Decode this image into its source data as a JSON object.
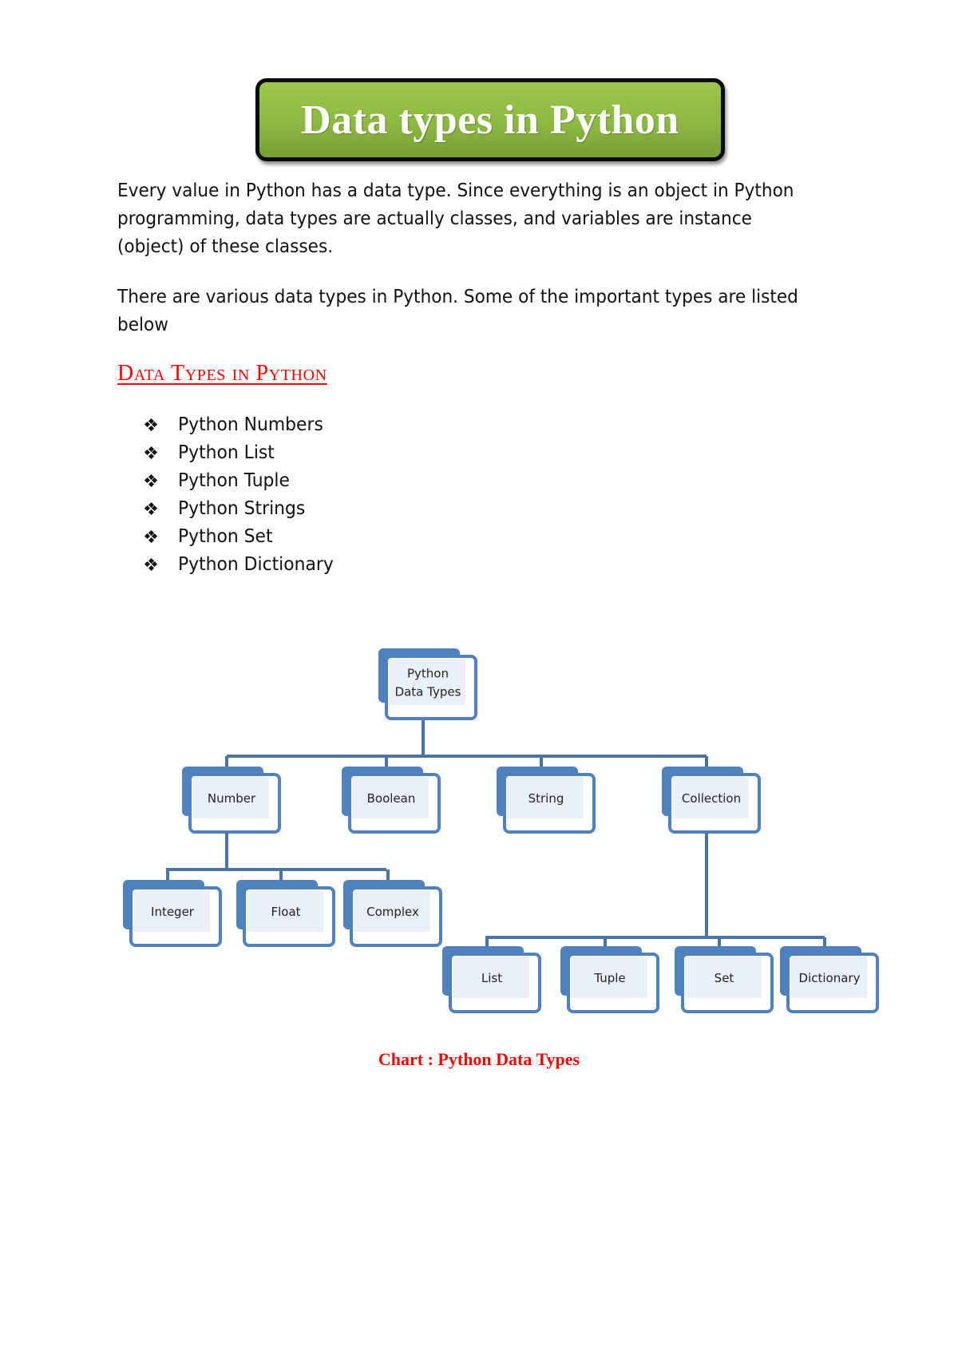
{
  "title": "Data types in Python",
  "paragraphs": [
    "Every value in Python has a data type. Since everything is an object in Python programming, data types are actually classes, and variables are instance (object) of these classes.",
    "There are various data types in Python. Some of the important types are listed below"
  ],
  "section_heading": "Data Types in Python",
  "bullet_icon": "diamond-cluster-bullet-icon",
  "list_items": [
    "Python Numbers",
    "Python List",
    "Python Tuple",
    "Python Strings",
    "Python Set",
    "Python Dictionary"
  ],
  "diagram": {
    "colors": {
      "accent": "#4f81bd",
      "fill": "#eaf0f8",
      "line": "#4a74a8"
    },
    "root": {
      "id": "root",
      "label": [
        "Python",
        "Data Types"
      ]
    },
    "level1": [
      {
        "id": "number",
        "label": "Number",
        "children": [
          "Integer",
          "Float",
          "Complex"
        ]
      },
      {
        "id": "boolean",
        "label": "Boolean",
        "children": []
      },
      {
        "id": "string",
        "label": "String",
        "children": []
      },
      {
        "id": "collection",
        "label": "Collection",
        "children": [
          "List",
          "Tuple",
          "Set",
          "Dictionary"
        ]
      }
    ]
  },
  "caption": "Chart : Python Data Types"
}
